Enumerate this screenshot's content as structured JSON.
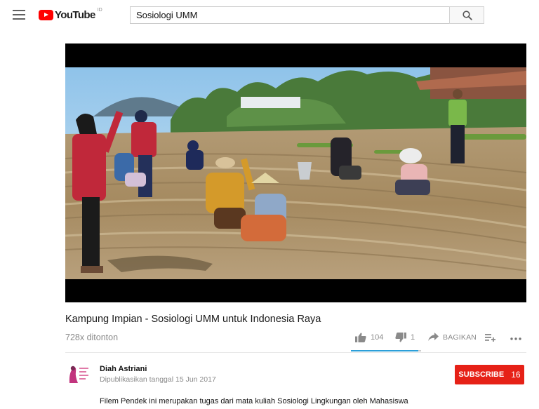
{
  "header": {
    "logo_text": "YouTube",
    "logo_region": "ID",
    "search_value": "Sosiologi UMM"
  },
  "video": {
    "title": "Kampung Impian - Sosiologi UMM untuk Indonesia Raya",
    "views": "728x ditonton",
    "likes": "104",
    "dislikes": "1",
    "share_label": "BAGIKAN"
  },
  "channel": {
    "name": "Diah Astriani",
    "published": "Dipublikasikan tanggal 15 Jun 2017",
    "subscribe_label": "SUBSCRIBE",
    "subscriber_count": "16"
  },
  "description": {
    "line1": "Filem Pendek ini  merupakan tugas dari mata kuliah Sosiologi Lingkungan oleh Mahasiswa"
  },
  "sentiment": {
    "like_fraction": 0.96
  },
  "colors": {
    "brand_red": "#ff0000",
    "subscribe_red": "#e62117",
    "sentiment_blue": "#2c9fd9"
  },
  "icons": [
    "menu-icon",
    "youtube-logo-icon",
    "search-icon",
    "thumbs-up-icon",
    "thumbs-down-icon",
    "share-icon",
    "add-to-playlist-icon",
    "more-icon"
  ]
}
